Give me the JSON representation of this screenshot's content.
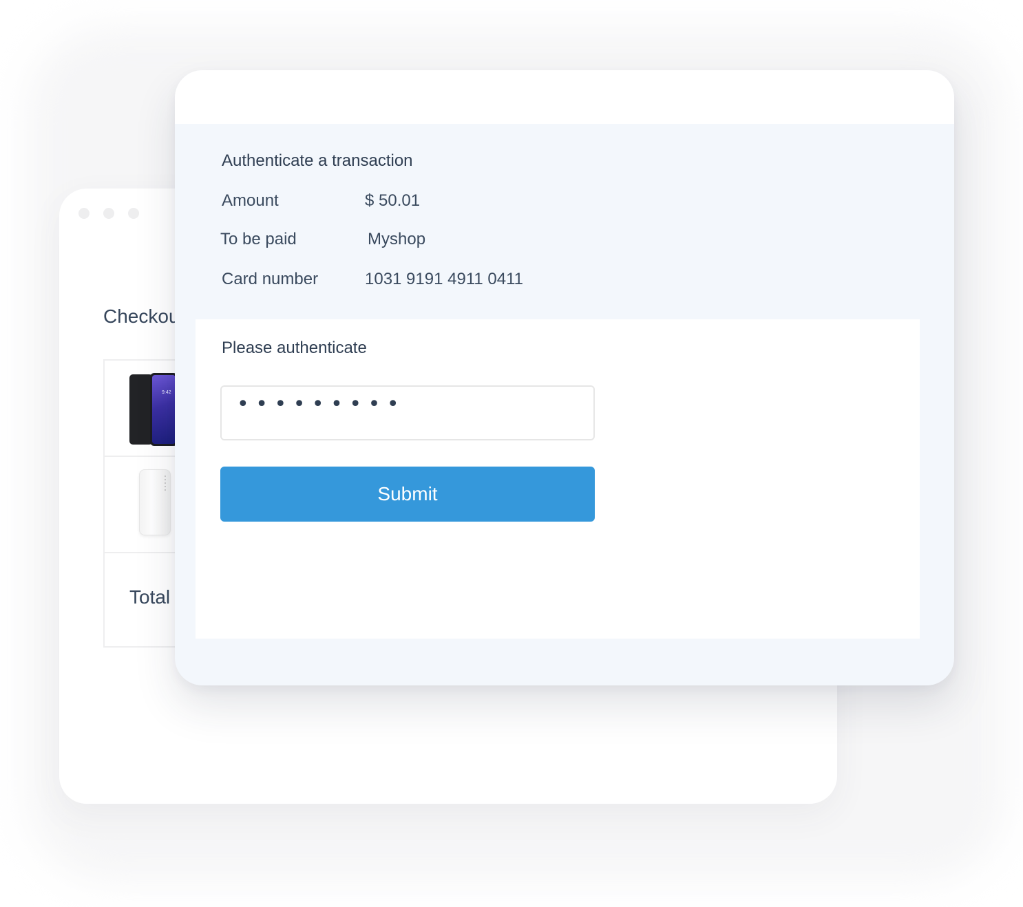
{
  "checkout_window": {
    "title": "Checkout",
    "products": [
      {
        "name": "phone",
        "image_time": "9:42"
      },
      {
        "name": "power bank"
      }
    ],
    "total_label": "Total"
  },
  "auth_window": {
    "title": "Authenticate a transaction",
    "details": [
      {
        "label": "Amount",
        "value": "$ 50.01"
      },
      {
        "label": "To be paid",
        "value": "Myshop"
      },
      {
        "label": "Card number",
        "value": "1031 9191 4911 0411"
      }
    ],
    "prompt": "Please authenticate",
    "code_field_value": "•  •  •  •  •  •  •  •  •",
    "submit_label": "Submit"
  },
  "colors": {
    "accent": "#3598db",
    "panel_background": "#f3f7fc",
    "text": "#2f3e52"
  }
}
